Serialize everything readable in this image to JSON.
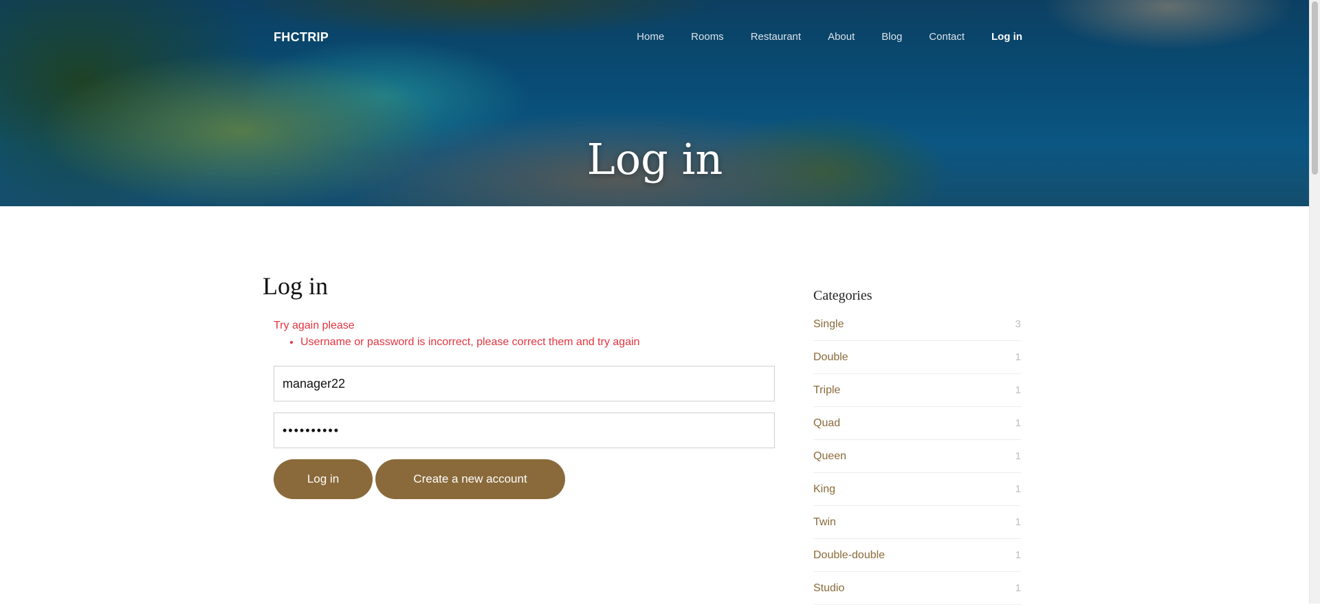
{
  "header": {
    "brand": "FHCTRIP",
    "nav": [
      {
        "label": "Home"
      },
      {
        "label": "Rooms"
      },
      {
        "label": "Restaurant"
      },
      {
        "label": "About"
      },
      {
        "label": "Blog"
      },
      {
        "label": "Contact"
      },
      {
        "label": "Log in"
      }
    ],
    "hero_title": "Log in"
  },
  "login": {
    "heading": "Log in",
    "error_title": "Try again please",
    "error_items": [
      "Username or password is incorrect, please correct them and try again"
    ],
    "username_value": "manager22",
    "password_value": "••••••••••",
    "login_button": "Log in",
    "create_button": "Create a new account"
  },
  "categories": {
    "title": "Categories",
    "items": [
      {
        "name": "Single",
        "count": "3"
      },
      {
        "name": "Double",
        "count": "1"
      },
      {
        "name": "Triple",
        "count": "1"
      },
      {
        "name": "Quad",
        "count": "1"
      },
      {
        "name": "Queen",
        "count": "1"
      },
      {
        "name": "King",
        "count": "1"
      },
      {
        "name": "Twin",
        "count": "1"
      },
      {
        "name": "Double-double",
        "count": "1"
      },
      {
        "name": "Studio",
        "count": "1"
      }
    ]
  },
  "colors": {
    "accent": "#8a6a3a",
    "error": "#e3343f"
  }
}
